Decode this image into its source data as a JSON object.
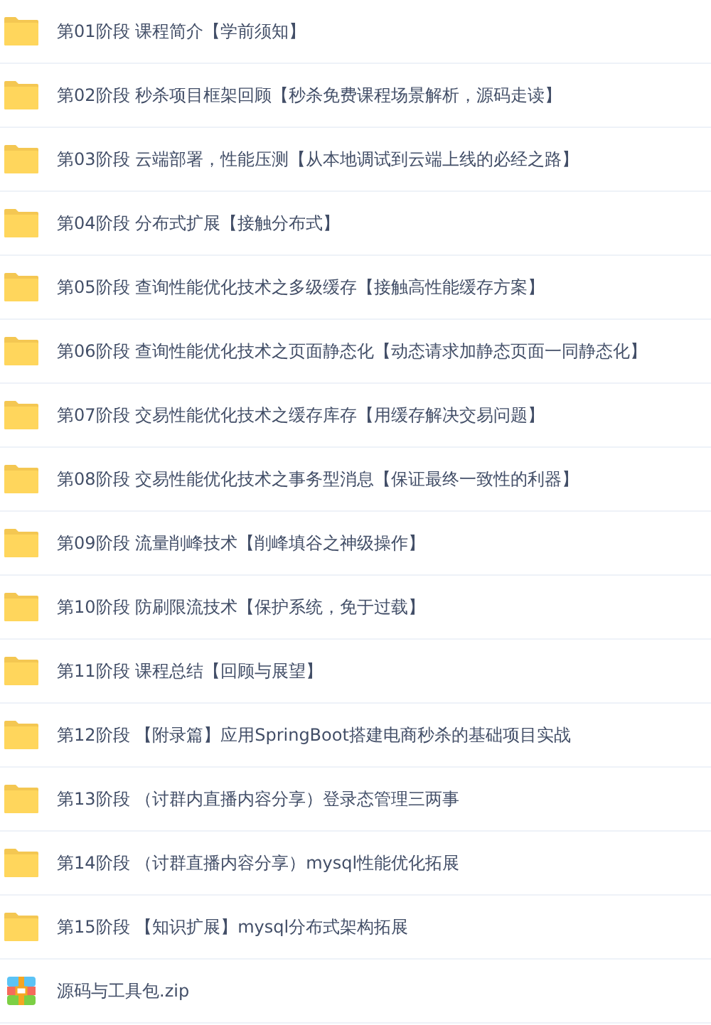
{
  "files": [
    {
      "kind": "folder",
      "name": "第01阶段 课程简介【学前须知】"
    },
    {
      "kind": "folder",
      "name": "第02阶段 秒杀项目框架回顾【秒杀免费课程场景解析，源码走读】"
    },
    {
      "kind": "folder",
      "name": "第03阶段 云端部署，性能压测【从本地调试到云端上线的必经之路】"
    },
    {
      "kind": "folder",
      "name": "第04阶段 分布式扩展【接触分布式】"
    },
    {
      "kind": "folder",
      "name": "第05阶段 查询性能优化技术之多级缓存【接触高性能缓存方案】"
    },
    {
      "kind": "folder",
      "name": "第06阶段 查询性能优化技术之页面静态化【动态请求加静态页面一同静态化】"
    },
    {
      "kind": "folder",
      "name": "第07阶段 交易性能优化技术之缓存库存【用缓存解决交易问题】"
    },
    {
      "kind": "folder",
      "name": "第08阶段 交易性能优化技术之事务型消息【保证最终一致性的利器】"
    },
    {
      "kind": "folder",
      "name": "第09阶段 流量削峰技术【削峰填谷之神级操作】"
    },
    {
      "kind": "folder",
      "name": "第10阶段 防刷限流技术【保护系统，免于过载】"
    },
    {
      "kind": "folder",
      "name": "第11阶段 课程总结【回顾与展望】"
    },
    {
      "kind": "folder",
      "name": "第12阶段 【附录篇】应用SpringBoot搭建电商秒杀的基础项目实战"
    },
    {
      "kind": "folder",
      "name": "第13阶段 （讨群内直播内容分享）登录态管理三两事"
    },
    {
      "kind": "folder",
      "name": "第14阶段 （讨群直播内容分享）mysql性能优化拓展"
    },
    {
      "kind": "folder",
      "name": "第15阶段 【知识扩展】mysql分布式架构拓展"
    },
    {
      "kind": "zip",
      "name": "源码与工具包.zip"
    }
  ]
}
